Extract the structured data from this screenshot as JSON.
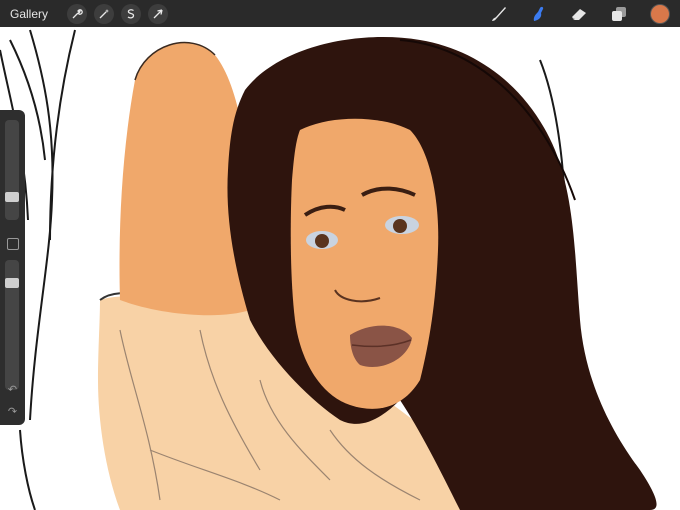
{
  "topbar": {
    "gallery_label": "Gallery",
    "left_tools": [
      {
        "name": "actions-icon"
      },
      {
        "name": "adjustments-icon"
      },
      {
        "name": "selection-icon"
      },
      {
        "name": "transform-icon"
      }
    ],
    "right_tools": [
      {
        "name": "brush-icon",
        "active": false
      },
      {
        "name": "smudge-icon",
        "active": true
      },
      {
        "name": "eraser-icon",
        "active": false
      },
      {
        "name": "layers-icon",
        "active": false
      }
    ]
  },
  "sidebar": {
    "brush_size_level": 0.2,
    "opacity_level": 0.85
  },
  "colors": {
    "active_color": "#d9784a",
    "active_tool": "#3b7bf0",
    "hair": "#2e140d",
    "skin": "#f0a86b",
    "blouse": "#f8d2a6",
    "lips": "#8a5446"
  }
}
